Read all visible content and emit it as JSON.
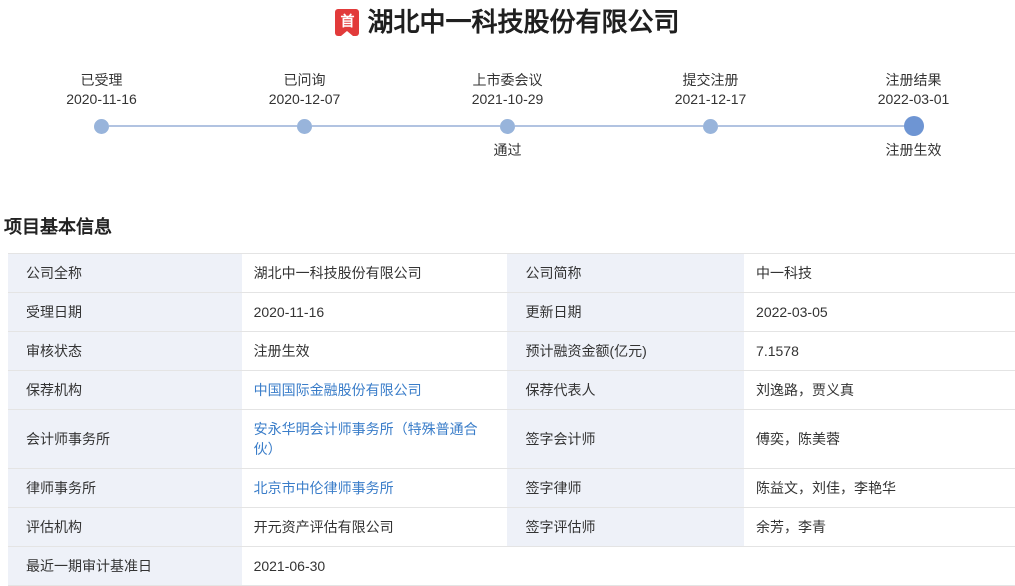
{
  "page": {
    "title": "湖北中一科技股份有限公司",
    "badge_text": "首"
  },
  "timeline": {
    "stages": [
      {
        "label": "已受理",
        "date": "2020-11-16",
        "sub": ""
      },
      {
        "label": "已问询",
        "date": "2020-12-07",
        "sub": ""
      },
      {
        "label": "上市委会议",
        "date": "2021-10-29",
        "sub": "通过"
      },
      {
        "label": "提交注册",
        "date": "2021-12-17",
        "sub": ""
      },
      {
        "label": "注册结果",
        "date": "2022-03-01",
        "sub": "注册生效"
      }
    ]
  },
  "section": {
    "title": "项目基本信息"
  },
  "info_table": {
    "rows": [
      {
        "k1": "公司全称",
        "v1": "湖北中一科技股份有限公司",
        "k2": "公司简称",
        "v2": "中一科技"
      },
      {
        "k1": "受理日期",
        "v1": "2020-11-16",
        "k2": "更新日期",
        "v2": "2022-03-05"
      },
      {
        "k1": "审核状态",
        "v1": "注册生效",
        "k2": "预计融资金额(亿元)",
        "v2": "7.1578"
      },
      {
        "k1": "保荐机构",
        "v1": "中国国际金融股份有限公司",
        "k2": "保荐代表人",
        "v2": "刘逸路，贾义真"
      },
      {
        "k1": "会计师事务所",
        "v1": "安永华明会计师事务所（特殊普通合伙）",
        "k2": "签字会计师",
        "v2": "傅奕，陈美蓉"
      },
      {
        "k1": "律师事务所",
        "v1": "北京市中伦律师事务所",
        "k2": "签字律师",
        "v2": "陈益文，刘佳，李艳华"
      },
      {
        "k1": "评估机构",
        "v1": "开元资产评估有限公司",
        "k2": "签字评估师",
        "v2": "余芳，李青"
      },
      {
        "k1": "最近一期审计基准日",
        "v1": "2021-06-30",
        "k2": "",
        "v2": ""
      }
    ]
  },
  "colors": {
    "badge_red": "#e23b3b",
    "link_blue": "#3a7dc9",
    "dot_blue": "#98b4db",
    "dot_active_blue": "#6e95d3",
    "timeline_line": "#b1c3e1",
    "label_cell_bg": "#eef1f8"
  }
}
